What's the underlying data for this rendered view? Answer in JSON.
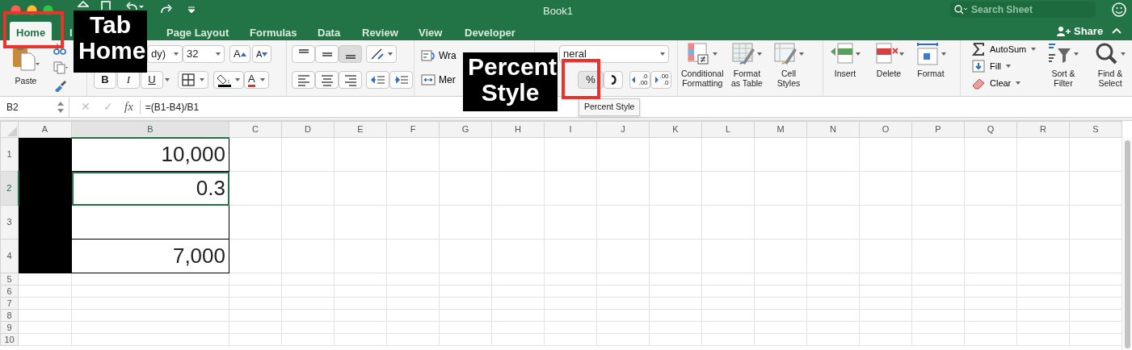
{
  "window": {
    "title": "Book1"
  },
  "search": {
    "placeholder": "Search Sheet"
  },
  "tabs": [
    {
      "label": "Home",
      "selected": true
    },
    {
      "label": "I",
      "selected": false
    },
    {
      "label": "Page Layout",
      "selected": false
    },
    {
      "label": "Formulas",
      "selected": false
    },
    {
      "label": "Data",
      "selected": false
    },
    {
      "label": "Review",
      "selected": false
    },
    {
      "label": "View",
      "selected": false
    },
    {
      "label": "Developer",
      "selected": false
    }
  ],
  "share": {
    "label": "Share"
  },
  "ribbon": {
    "paste": "Paste",
    "font_name": "dy)",
    "font_size": "32",
    "grow": "A",
    "shrink": "A",
    "bold": "B",
    "italic": "I",
    "underline": "U",
    "font_color": "A",
    "wrap_text": "Wra",
    "merge": "Mer",
    "number_format": "neral",
    "percent": "%",
    "decimal_buttons": [
      {
        "top": ".0",
        "bottom": ".00"
      },
      {
        "top": ".00",
        "bottom": ".0"
      }
    ],
    "styles_buttons": [
      {
        "kind": "conditional",
        "label": "Conditional\nFormatting"
      },
      {
        "kind": "table",
        "label": "Format\nas Table"
      },
      {
        "kind": "cell_styles",
        "label": "Cell\nStyles"
      }
    ],
    "cells_buttons": [
      {
        "kind": "insert",
        "label": "Insert"
      },
      {
        "kind": "delete",
        "label": "Delete"
      },
      {
        "kind": "format",
        "label": "Format"
      }
    ],
    "editing_items": [
      {
        "kind": "autosum",
        "label": "AutoSum"
      },
      {
        "kind": "fill",
        "label": "Fill"
      },
      {
        "kind": "clear",
        "label": "Clear"
      }
    ],
    "editing_buttons": [
      {
        "kind": "sort",
        "label": "Sort &\nFilter"
      },
      {
        "kind": "find",
        "label": "Find &\nSelect"
      }
    ]
  },
  "formula_bar": {
    "name_box": "B2",
    "cancel": "✕",
    "enter": "✓",
    "fx": "fx",
    "formula": "=(B1-B4)/B1"
  },
  "tooltip": "Percent Style",
  "columns": [
    {
      "label": "A",
      "selected": false
    },
    {
      "label": "B",
      "selected": true
    },
    {
      "label": "C",
      "selected": false
    },
    {
      "label": "D",
      "selected": false
    },
    {
      "label": "E",
      "selected": false
    },
    {
      "label": "F",
      "selected": false
    },
    {
      "label": "G",
      "selected": false
    },
    {
      "label": "H",
      "selected": false
    },
    {
      "label": "I",
      "selected": false
    },
    {
      "label": "J",
      "selected": false
    },
    {
      "label": "K",
      "selected": false
    },
    {
      "label": "L",
      "selected": false
    },
    {
      "label": "M",
      "selected": false
    },
    {
      "label": "N",
      "selected": false
    },
    {
      "label": "O",
      "selected": false
    },
    {
      "label": "P",
      "selected": false
    },
    {
      "label": "Q",
      "selected": false
    },
    {
      "label": "R",
      "selected": false
    },
    {
      "label": "S",
      "selected": false
    }
  ],
  "rows": [
    {
      "header": "1",
      "a_redacted": true,
      "b": "10,000",
      "selected": false
    },
    {
      "header": "2",
      "a_redacted": true,
      "b": "0.3",
      "selected": true
    },
    {
      "header": "3",
      "a_redacted": true,
      "selected": false
    },
    {
      "header": "4",
      "a_redacted": true,
      "b": "7,000",
      "selected": false
    },
    {
      "header": "5",
      "a_redacted": false,
      "selected": false
    },
    {
      "header": "6",
      "a_redacted": false,
      "selected": false
    },
    {
      "header": "7",
      "a_redacted": false,
      "selected": false
    },
    {
      "header": "8",
      "a_redacted": false,
      "selected": false
    },
    {
      "header": "9",
      "a_redacted": false,
      "selected": false
    },
    {
      "header": "10",
      "a_redacted": false,
      "selected": false
    }
  ],
  "callouts": [
    {
      "kind": "tab",
      "text": "Tab\nHome"
    },
    {
      "kind": "percent",
      "text": "Percent\nStyle"
    }
  ]
}
